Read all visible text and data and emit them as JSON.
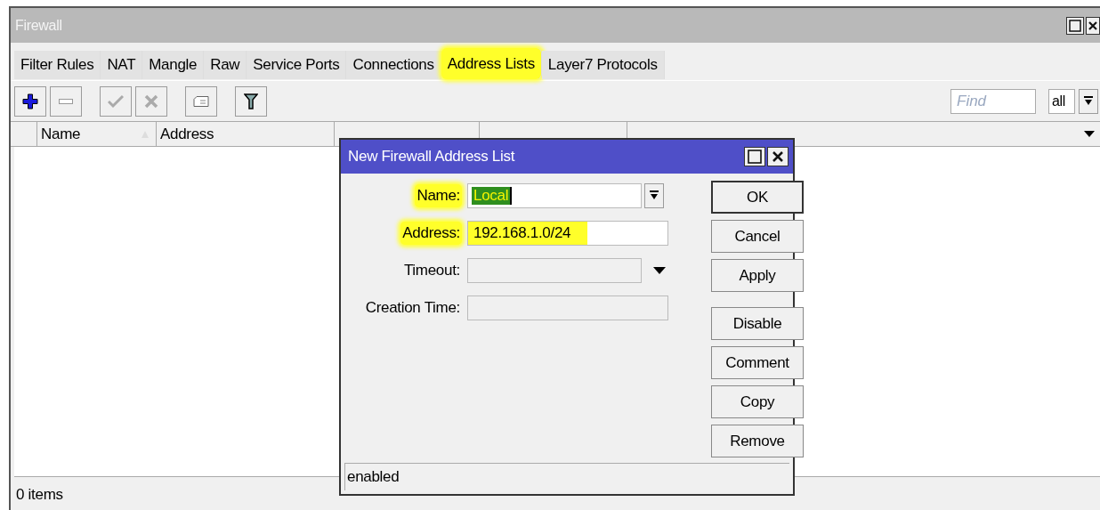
{
  "window": {
    "title": "Firewall"
  },
  "tabs": [
    {
      "label": "Filter Rules",
      "selected": false,
      "highlighted": false
    },
    {
      "label": "NAT",
      "selected": false,
      "highlighted": false
    },
    {
      "label": "Mangle",
      "selected": false,
      "highlighted": false
    },
    {
      "label": "Raw",
      "selected": false,
      "highlighted": false
    },
    {
      "label": "Service Ports",
      "selected": false,
      "highlighted": false
    },
    {
      "label": "Connections",
      "selected": false,
      "highlighted": false
    },
    {
      "label": "Address Lists",
      "selected": true,
      "highlighted": true
    },
    {
      "label": "Layer7 Protocols",
      "selected": false,
      "highlighted": false
    }
  ],
  "toolbar": {
    "find_placeholder": "Find",
    "filter_value": "all"
  },
  "table": {
    "columns": [
      "Name",
      "Address"
    ]
  },
  "status_bar": "0 items",
  "dialog": {
    "title": "New Firewall Address List",
    "fields": [
      {
        "label": "Name:",
        "value": "Local",
        "kind": "combo",
        "highlighted": true,
        "selected_text": true
      },
      {
        "label": "Address:",
        "value": "192.168.1.0/24",
        "kind": "text",
        "highlighted": true,
        "selected_text": false
      },
      {
        "label": "Timeout:",
        "kind": "dropdown",
        "highlighted": false
      },
      {
        "label": "Creation Time:",
        "kind": "readonly",
        "highlighted": false
      }
    ],
    "buttons": [
      "OK",
      "Cancel",
      "Apply",
      "Disable",
      "Comment",
      "Copy",
      "Remove"
    ],
    "status": "enabled"
  }
}
